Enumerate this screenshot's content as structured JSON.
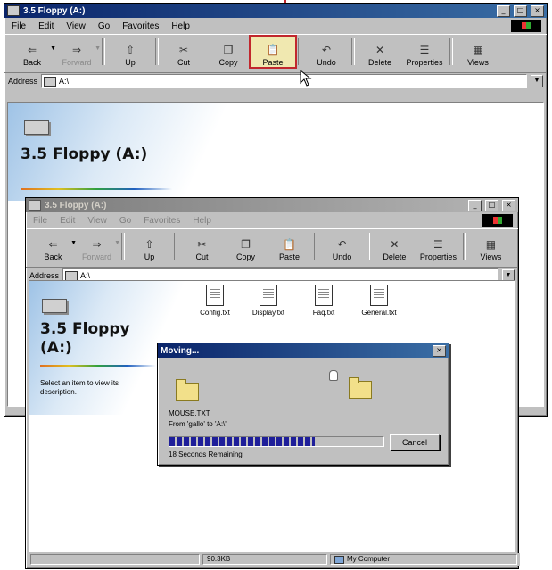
{
  "outer": {
    "title": "3.5 Floppy (A:)",
    "menu": [
      "File",
      "Edit",
      "View",
      "Go",
      "Favorites",
      "Help"
    ],
    "toolbar": [
      {
        "label": "Back",
        "icon": "back-arrow-icon",
        "glyph": "⇐",
        "enabled": true
      },
      {
        "label": "Forward",
        "icon": "forward-arrow-icon",
        "glyph": "⇒",
        "enabled": false
      },
      {
        "label": "Up",
        "icon": "up-folder-icon",
        "glyph": "⇧",
        "enabled": true
      },
      {
        "label": "Cut",
        "icon": "scissors-icon",
        "glyph": "✂",
        "enabled": true
      },
      {
        "label": "Copy",
        "icon": "copy-icon",
        "glyph": "❐",
        "enabled": true
      },
      {
        "label": "Paste",
        "icon": "paste-icon",
        "glyph": "📋",
        "enabled": true
      },
      {
        "label": "Undo",
        "icon": "undo-icon",
        "glyph": "↶",
        "enabled": true
      },
      {
        "label": "Delete",
        "icon": "delete-x-icon",
        "glyph": "✕",
        "enabled": true
      },
      {
        "label": "Properties",
        "icon": "properties-icon",
        "glyph": "☰",
        "enabled": true
      },
      {
        "label": "Views",
        "icon": "views-icon",
        "glyph": "▦",
        "enabled": true
      }
    ],
    "address_label": "Address",
    "address_value": "A:\\",
    "heading": "3.5 Floppy (A:)"
  },
  "inner": {
    "title": "3.5 Floppy (A:)",
    "menu": [
      "File",
      "Edit",
      "View",
      "Go",
      "Favorites",
      "Help"
    ],
    "toolbar": [
      {
        "label": "Back",
        "icon": "back-arrow-icon",
        "glyph": "⇐",
        "enabled": true
      },
      {
        "label": "Forward",
        "icon": "forward-arrow-icon",
        "glyph": "⇒",
        "enabled": false
      },
      {
        "label": "Up",
        "icon": "up-folder-icon",
        "glyph": "⇧",
        "enabled": true
      },
      {
        "label": "Cut",
        "icon": "scissors-icon",
        "glyph": "✂",
        "enabled": true
      },
      {
        "label": "Copy",
        "icon": "copy-icon",
        "glyph": "❐",
        "enabled": true
      },
      {
        "label": "Paste",
        "icon": "paste-icon",
        "glyph": "📋",
        "enabled": true
      },
      {
        "label": "Undo",
        "icon": "undo-icon",
        "glyph": "↶",
        "enabled": true
      },
      {
        "label": "Delete",
        "icon": "delete-x-icon",
        "glyph": "✕",
        "enabled": true
      },
      {
        "label": "Properties",
        "icon": "properties-icon",
        "glyph": "☰",
        "enabled": true
      },
      {
        "label": "Views",
        "icon": "views-icon",
        "glyph": "▦",
        "enabled": true
      }
    ],
    "address_label": "Address",
    "address_value": "A:\\",
    "heading": "3.5 Floppy (A:)",
    "description": "Select an item to view its description.",
    "files": [
      "Config.txt",
      "Display.txt",
      "Faq.txt",
      "General.txt"
    ],
    "status_size": "90.3KB",
    "status_zone": "My Computer"
  },
  "dialog": {
    "title": "Moving...",
    "filename": "MOUSE.TXT",
    "from_to": "From 'gallo' to 'A:\\'",
    "progress": 0.68,
    "remaining": "18 Seconds Remaining",
    "cancel_label": "Cancel"
  },
  "colors": {
    "highlight": "#c1272d",
    "title_active": "#0a246a",
    "progress": "#1f1f9a"
  }
}
